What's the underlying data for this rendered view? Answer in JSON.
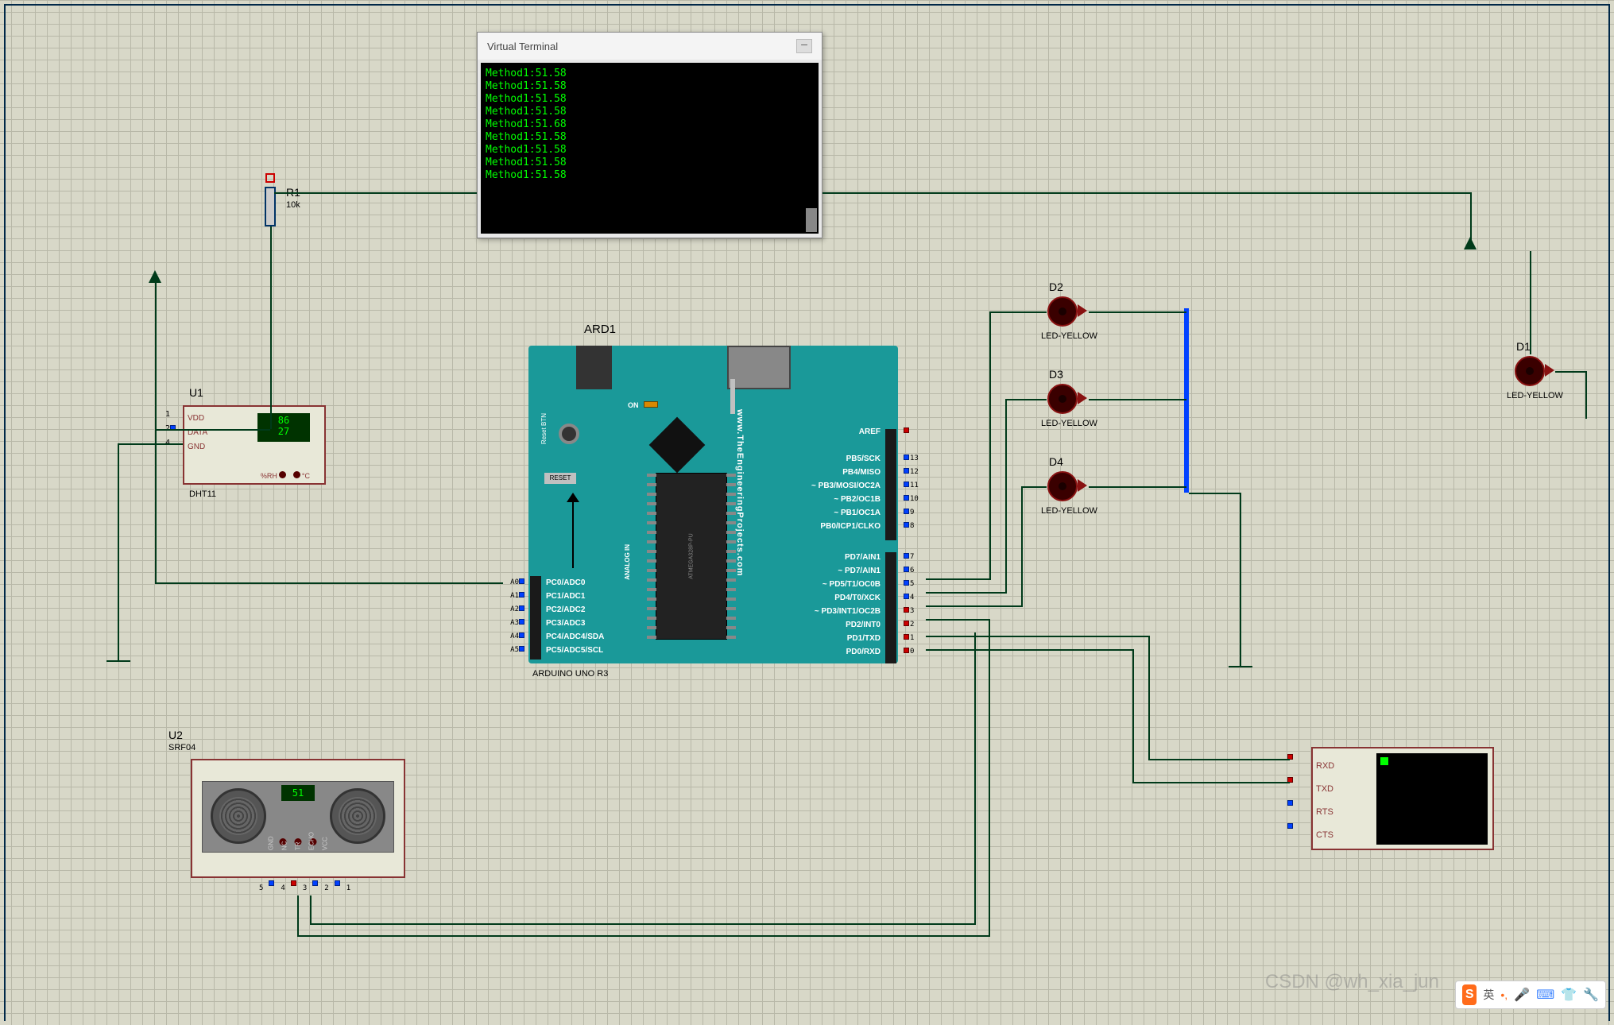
{
  "terminal": {
    "title": "Virtual Terminal",
    "lines": [
      "Method1:51.58",
      "Method1:51.58",
      "Method1:51.58",
      "Method1:51.58",
      "Method1:51.68",
      "Method1:51.58",
      "Method1:51.58",
      "Method1:51.58",
      "Method1:51.58"
    ]
  },
  "r1": {
    "ref": "R1",
    "value": "10k"
  },
  "u1": {
    "ref": "U1",
    "part": "DHT11",
    "humidity": "86",
    "temp": "27",
    "pins": [
      "VDD",
      "DATA",
      "GND"
    ],
    "rh": "%RH",
    "c": "°C"
  },
  "u2": {
    "ref": "U2",
    "part": "SRF04",
    "reading": "51",
    "pins": [
      "GND",
      "NC",
      "TR",
      "ECHO",
      "VCC"
    ]
  },
  "ard": {
    "ref": "ARD1",
    "part": "ARDUINO UNO R3",
    "url": "www.TheEngineeringProjects.com",
    "reset": "RESET",
    "reset_btn": "Reset BTN",
    "on": "ON",
    "analog": "ANALOG IN",
    "chip": "ATMEGA328P-PU",
    "left_pins": [
      "PC0/ADC0",
      "PC1/ADC1",
      "PC2/ADC2",
      "PC3/ADC3",
      "PC4/ADC4/SDA",
      "PC5/ADC5/SCL"
    ],
    "left_ext": [
      "A0",
      "A1",
      "A2",
      "A3",
      "A4",
      "A5"
    ],
    "right_top": [
      "AREF",
      "",
      "PB5/SCK",
      "PB4/MISO",
      "~ PB3/MOSI/OC2A",
      "~ PB2/OC1B",
      "~ PB1/OC1A",
      "PB0/ICP1/CLKO"
    ],
    "right_bot": [
      "PD7/AIN1",
      "~ PD7/AIN1",
      "~ PD5/T1/OC0B",
      "PD4/T0/XCK",
      "~ PD3/INT1/OC2B",
      "PD2/INT0",
      "PD1/TXD",
      "PD0/RXD"
    ],
    "right_nums_top": [
      "",
      "",
      "13",
      "12",
      "11",
      "10",
      "9",
      "8"
    ],
    "right_nums_bot": [
      "7",
      "6",
      "5",
      "4",
      "3",
      "2",
      "1",
      "0"
    ]
  },
  "leds": {
    "d1": {
      "ref": "D1",
      "part": "LED-YELLOW"
    },
    "d2": {
      "ref": "D2",
      "part": "LED-YELLOW"
    },
    "d3": {
      "ref": "D3",
      "part": "LED-YELLOW"
    },
    "d4": {
      "ref": "D4",
      "part": "LED-YELLOW"
    }
  },
  "serial_term": {
    "pins": [
      "RXD",
      "TXD",
      "RTS",
      "CTS"
    ]
  },
  "watermark": "CSDN @wh_xia_jun",
  "ime": {
    "logo": "S",
    "lang": "英",
    "sep": "•,"
  }
}
